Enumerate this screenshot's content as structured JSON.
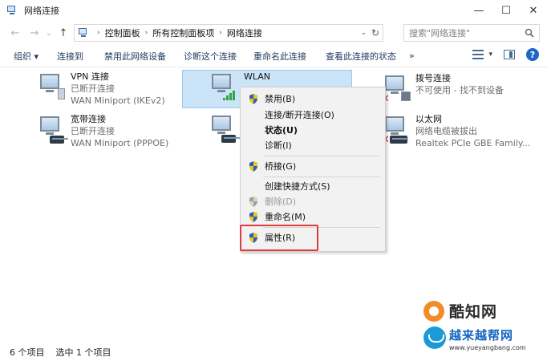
{
  "window": {
    "title": "网络连接",
    "minimize": "—",
    "maximize": "☐",
    "close": "✕"
  },
  "address_bar": {
    "back": "←",
    "forward": "→",
    "dropdown": "⌄",
    "up": "↑",
    "crumb_sep": "›",
    "breadcrumb": [
      "控制面板",
      "所有控制面板项",
      "网络连接"
    ],
    "dropdown_glyph": "⌄",
    "refresh_glyph": "↻"
  },
  "search": {
    "placeholder": "搜索\"网络连接\""
  },
  "toolbar": {
    "organize": "组织 ▾",
    "connect_to": "连接到",
    "disable_device": "禁用此网络设备",
    "diagnose": "诊断这个连接",
    "rename": "重命名此连接",
    "view_status": "查看此连接的状态",
    "more": "»",
    "view_dropdown": "▾",
    "help": "?"
  },
  "connections": [
    {
      "name": "VPN 连接",
      "status": "已断开连接",
      "device": "WAN Miniport (IKEv2)"
    },
    {
      "name": "宽带连接",
      "status": "已断开连接",
      "device": "WAN Miniport (PPPOE)"
    },
    {
      "name": "WLAN",
      "status": "",
      "device": ""
    },
    {
      "name": "拨号连接",
      "status": "不可使用 - 找不到设备",
      "device": ""
    },
    {
      "name": "以太网",
      "status": "网络电缆被拔出",
      "device": "Realtek PCIe GBE Family..."
    }
  ],
  "context_menu": {
    "disable": "禁用(B)",
    "connect_disconnect": "连接/断开连接(O)",
    "status": "状态(U)",
    "diagnose": "诊断(I)",
    "bridge": "桥接(G)",
    "create_shortcut": "创建快捷方式(S)",
    "delete": "删除(D)",
    "rename": "重命名(M)",
    "properties": "属性(R)"
  },
  "statusbar": {
    "item_count": "6 个项目",
    "selected": "选中 1 个项目"
  },
  "watermarks": {
    "logo_text": "酷知网",
    "site_name": "越来越帮网",
    "site_url": "www.yueyangbang.com"
  },
  "colors": {
    "accent": "#1c67c6",
    "selection": "#cce4f7",
    "highlight_border": "#e0393e"
  }
}
